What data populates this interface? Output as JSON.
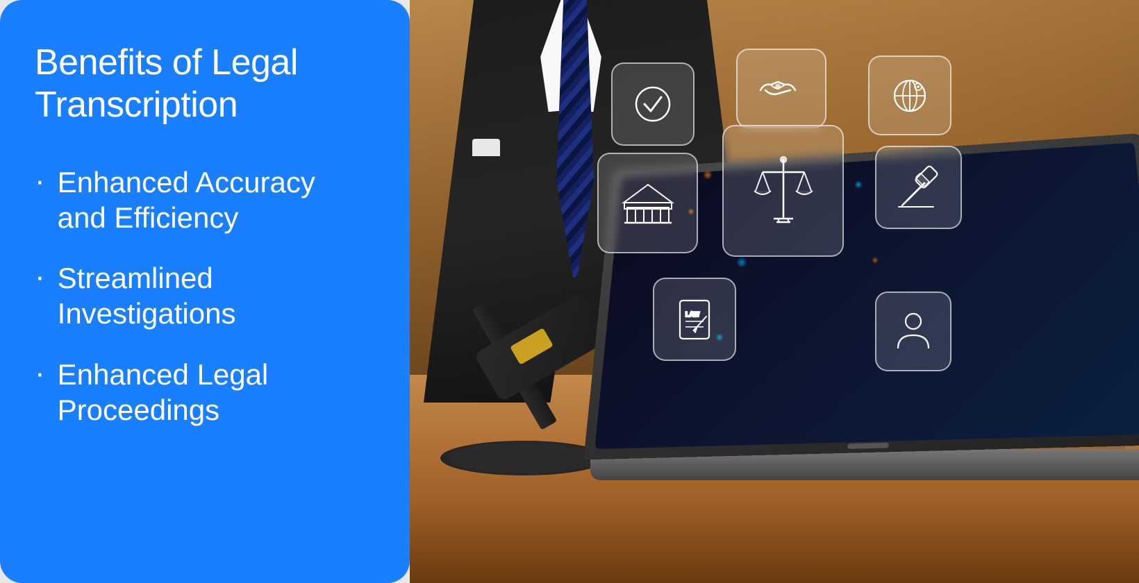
{
  "leftPanel": {
    "title": "Benefits of Legal\nTranscription",
    "bullets": [
      {
        "id": "accuracy",
        "text": "Enhanced Accuracy\nand Efficiency"
      },
      {
        "id": "investigations",
        "text": "Streamlined\nInvestigations"
      },
      {
        "id": "legal",
        "text": "Enhanced Legal\nProceedings"
      }
    ]
  },
  "icons": [
    {
      "id": "checkmark",
      "label": "checkmark-icon"
    },
    {
      "id": "handshake",
      "label": "handshake-icon"
    },
    {
      "id": "globe",
      "label": "globe-icon"
    },
    {
      "id": "courthouse",
      "label": "courthouse-icon"
    },
    {
      "id": "scales",
      "label": "scales-icon"
    },
    {
      "id": "gavel-small",
      "label": "gavel-small-icon"
    },
    {
      "id": "law-document",
      "label": "law-document-icon"
    },
    {
      "id": "person",
      "label": "person-icon"
    }
  ],
  "colors": {
    "panelBg": "#1a7fff",
    "panelText": "#ffffff",
    "accentBlue": "#00aaff",
    "accentOrange": "#ff8800"
  }
}
